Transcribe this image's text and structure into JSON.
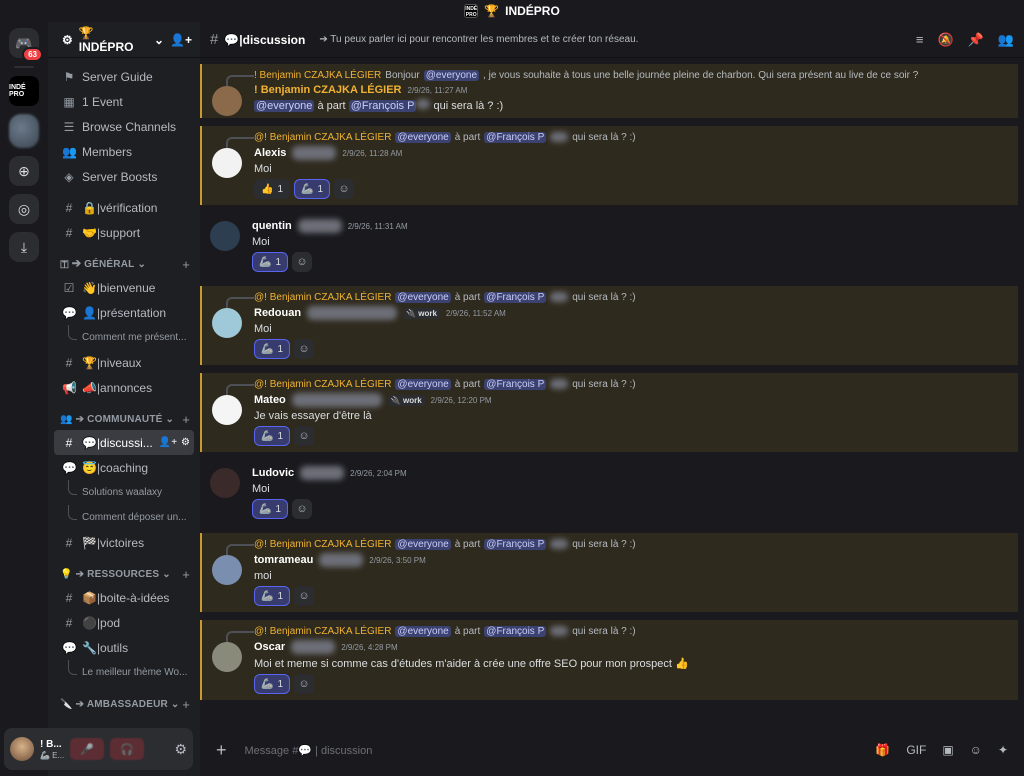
{
  "window": {
    "title": "INDÉPRO",
    "title_icon": "🏆",
    "logo_text": "INDÉ PRO"
  },
  "rail": {
    "dm_badge": "63",
    "indepro_logo": "INDÉ PRO"
  },
  "sidebar": {
    "guild_name": "🏆 INDÉPRO",
    "top_items": [
      {
        "icon": "server-guide",
        "label": "Server Guide"
      },
      {
        "icon": "calendar",
        "label": "1 Event"
      },
      {
        "icon": "browse",
        "label": "Browse Channels"
      },
      {
        "icon": "members",
        "label": "Members"
      },
      {
        "icon": "boost",
        "label": "Server Boosts"
      }
    ],
    "channels_top": [
      {
        "label": "🔒|vérification"
      },
      {
        "label": "🤝|support"
      }
    ],
    "cat_general": "🇹 ➔ GÉNÉRAL",
    "general": [
      {
        "label": "👋|bienvenue"
      },
      {
        "label": "👤|présentation"
      }
    ],
    "general_thread": "Comment me présent...",
    "general2": [
      {
        "label": "🏆|niveaux"
      },
      {
        "label": "📣|annonces"
      }
    ],
    "cat_communaute": "👥 ➔ COMMUNAUTÉ",
    "active_channel": "💬|discussi...",
    "coaching": "😇|coaching",
    "coaching_threads": [
      "Solutions waalaxy",
      "Comment déposer un..."
    ],
    "victoires": "🏁|victoires",
    "cat_ressources": "💡 ➔ RESSOURCES",
    "ressources": [
      {
        "label": "📦|boite-à-idées"
      },
      {
        "label": "⚫|pod"
      },
      {
        "label": "🔧|outils"
      }
    ],
    "outils_thread": "Le meilleur thème Wo...",
    "cat_ambassadeur": "🔪 ➔ AMBASSADEUR"
  },
  "user_panel": {
    "name": "! B...",
    "status": "🦾 E..."
  },
  "channel": {
    "name": "💬|discussion",
    "topic": "➔ Tu peux parler ici pour rencontrer les membres et te créer ton réseau."
  },
  "messages": [
    {
      "highlight": true,
      "reply": {
        "author": "! Benjamin CZAJKA LÉGIER",
        "pre": "Bonjour",
        "mention": "@everyone",
        "post": ", je vous souhaite à tous une belle journée pleine de charbon. Qui sera présent au live de ce soir ?"
      },
      "author": "! Benjamin CZAJKA LÉGIER",
      "author_gold": true,
      "timestamp": "2/9/26, 11:27 AM",
      "text_mention1": "@everyone",
      "text_mid": "à part",
      "text_mention2": "@François P",
      "text_post": "qui sera là ? :)",
      "avatar": "#8a6a4a"
    },
    {
      "highlight": true,
      "reply": {
        "author": "@! Benjamin CZAJKA LÉGIER",
        "mention": "@everyone",
        "mid": "à part",
        "mention2": "@François P",
        "post": "qui sera là ? :)"
      },
      "author": "Alexis",
      "timestamp": "2/9/26, 11:28 AM",
      "text": "Moi",
      "reactions": [
        {
          "emoji": "👍",
          "count": "1",
          "me": false
        },
        {
          "emoji": "🦾",
          "count": "1",
          "me": true
        }
      ],
      "avatar": "#f2f2f2"
    },
    {
      "highlight": false,
      "author": "quentin",
      "timestamp": "2/9/26, 11:31 AM",
      "text": "Moi",
      "reactions": [
        {
          "emoji": "🦾",
          "count": "1",
          "me": true
        }
      ],
      "avatar": "#2c3e50"
    },
    {
      "highlight": true,
      "reply": {
        "author": "@! Benjamin CZAJKA LÉGIER",
        "mention": "@everyone",
        "mid": "à part",
        "mention2": "@François P",
        "post": "qui sera là ? :)"
      },
      "author": "Redouan",
      "tag": "🔌 work",
      "timestamp": "2/9/26, 11:52 AM",
      "text": "Moi",
      "reactions": [
        {
          "emoji": "🦾",
          "count": "1",
          "me": true
        }
      ],
      "avatar": "#9fc9d8"
    },
    {
      "highlight": true,
      "reply": {
        "author": "@! Benjamin CZAJKA LÉGIER",
        "mention": "@everyone",
        "mid": "à part",
        "mention2": "@François P",
        "post": "qui sera là ? :)"
      },
      "author": "Mateo",
      "tag": "🔌 work",
      "timestamp": "2/9/26, 12:20 PM",
      "text": "Je vais essayer d'être là",
      "reactions": [
        {
          "emoji": "🦾",
          "count": "1",
          "me": true
        }
      ],
      "avatar": "#f5f5f5"
    },
    {
      "highlight": false,
      "author": "Ludovic",
      "timestamp": "2/9/26, 2:04 PM",
      "text": "Moi",
      "reactions": [
        {
          "emoji": "🦾",
          "count": "1",
          "me": true
        }
      ],
      "avatar": "#3a2a2a"
    },
    {
      "highlight": true,
      "reply": {
        "author": "@! Benjamin CZAJKA LÉGIER",
        "mention": "@everyone",
        "mid": "à part",
        "mention2": "@François P",
        "post": "qui sera là ? :)"
      },
      "author": "tomrameau",
      "timestamp": "2/9/26, 3:50 PM",
      "text": "moi",
      "reactions": [
        {
          "emoji": "🦾",
          "count": "1",
          "me": true
        }
      ],
      "avatar": "#7a8fb0"
    },
    {
      "highlight": true,
      "reply": {
        "author": "@! Benjamin CZAJKA LÉGIER",
        "mention": "@everyone",
        "mid": "à part",
        "mention2": "@François P",
        "post": "qui sera là ? :)"
      },
      "author": "Oscar",
      "timestamp": "2/9/26, 4:28 PM",
      "text": "Moi et meme si comme cas d'études m'aider à crée une offre SEO pour mon prospect 👍",
      "reactions": [
        {
          "emoji": "🦾",
          "count": "1",
          "me": true
        }
      ],
      "avatar": "#8a8a7a"
    }
  ],
  "composer": {
    "placeholder": "Message #💬 | discussion"
  }
}
